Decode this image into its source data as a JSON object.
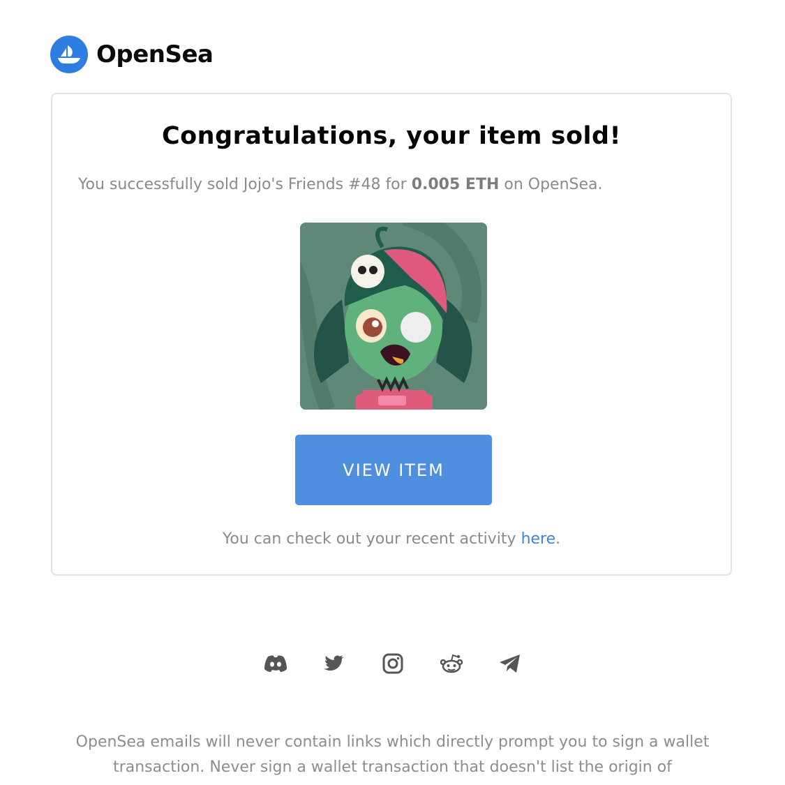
{
  "brand": {
    "name": "OpenSea",
    "logo_icon": "opensea-boat-icon",
    "accent_color": "#2d7ee0"
  },
  "card": {
    "title": "Congratulations, your item sold!",
    "sale": {
      "prefix": "You successfully sold Jojo's Friends #48 for ",
      "price": "0.005 ETH",
      "suffix": " on OpenSea."
    },
    "image_alt_icon": "nft-zombie-girl-image",
    "button_label": "VIEW ITEM",
    "button_color": "#4e8fe0",
    "activity_prefix": "You can check out your recent activity ",
    "activity_link": "here",
    "activity_suffix": "."
  },
  "social_icons": [
    "discord-icon",
    "twitter-icon",
    "instagram-icon",
    "reddit-icon",
    "telegram-icon"
  ],
  "disclaimer": "OpenSea emails will never contain links which directly prompt you to sign a wallet transaction. Never sign a wallet transaction that doesn't list the origin of"
}
